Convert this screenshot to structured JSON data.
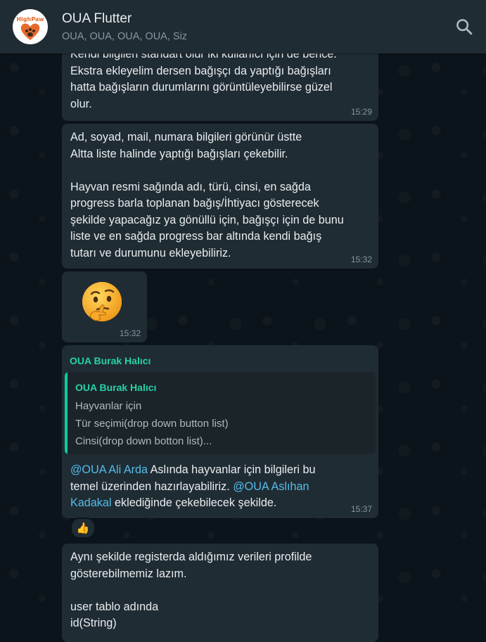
{
  "header": {
    "logo_text": "HighPaw",
    "title": "OUA Flutter",
    "subtitle": "OUA, OUA, OUA, OUA, Siz"
  },
  "messages": [
    {
      "text": "Kendi bilgileri standart olur iki kullanıcı için de bence.\nEkstra ekleyelim dersen bağışçı da yaptığı bağışları\nhatta bağışların durumlarını görüntüleyebilirse güzel\nolur.",
      "time": "15:29"
    },
    {
      "text": "Ad, soyad, mail, numara bilgileri görünür üstte\nAltta liste halinde yaptığı bağışları çekebilir.\n\nHayvan resmi sağında adı, türü, cinsi, en sağda\nprogress barla toplanan bağış/İhtiyacı gösterecek\nşekilde yapacağız ya gönüllü için, bağışçı için de bunu\nliste ve en sağda progress bar altında kendi bağış\ntutarı ve durumunu ekleyebiliriz.",
      "time": "15:32"
    },
    {
      "emoji": "thinking-face",
      "time": "15:32"
    },
    {
      "sender": "OUA Burak Halıcı",
      "quote": {
        "sender": "OUA Burak Halıcı",
        "text": "Hayvanlar için\nTür seçimi(drop down button list)\nCinsi(drop down botton list)..."
      },
      "mention1": "@OUA Ali Arda",
      "text1": " Aslında hayvanlar için bilgileri bu\ntemel üzerinden hazırlayabiliriz. ",
      "mention2": "@OUA Aslıhan\nKadakal",
      "text2": " eklediğinde çekebilecek şekilde.",
      "time": "15:37",
      "reaction": "👍"
    },
    {
      "text": "Aynı şekilde registerda aldığımız verileri profilde\ngösterebilmemiz lazım.\n\nuser tablo adında\nid(String)"
    }
  ]
}
